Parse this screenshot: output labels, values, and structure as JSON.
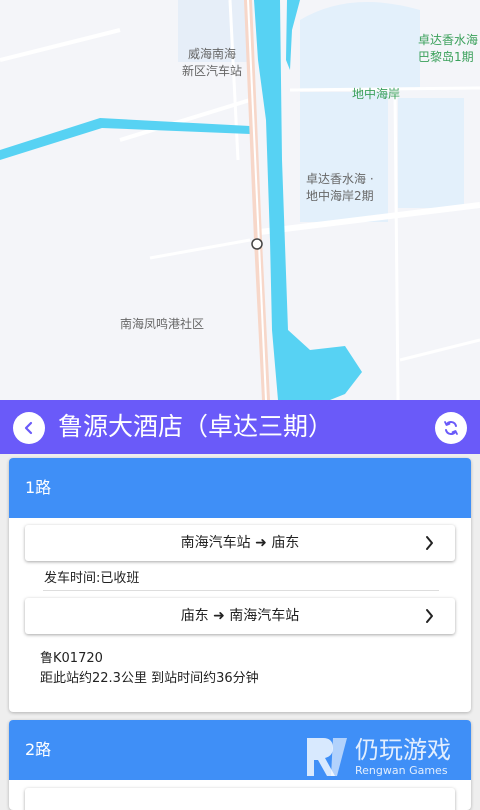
{
  "map": {
    "labels": {
      "station": "威海南海\n新区汽车站",
      "zhuoda_bali": "卓达香水海\n巴黎岛1期",
      "dizhonghaian": "地中海岸",
      "zhuoda_2": "卓达香水海 ·\n地中海岸2期",
      "nanhai_community": "南海凤鸣港社区"
    }
  },
  "header": {
    "title": "鲁源大酒店（卓达三期）",
    "back_icon": "chevron-left-icon",
    "refresh_icon": "refresh-icon"
  },
  "routes": [
    {
      "name": "1路",
      "directions": [
        {
          "label": "南海汽车站 ➜ 庙东",
          "status": "发车时间:已收班"
        },
        {
          "label": "庙东 ➜ 南海汽车站"
        }
      ],
      "bus_plate": "鲁K01720",
      "bus_info": "距此站约22.3公里 到站时间约36分钟"
    },
    {
      "name": "2路"
    }
  ],
  "watermark": {
    "name": "仍玩游戏",
    "sub": "Rengwan Games"
  },
  "colors": {
    "header": "#6a5af9",
    "card_header": "#3f8ff7",
    "water": "#57d2f3"
  }
}
